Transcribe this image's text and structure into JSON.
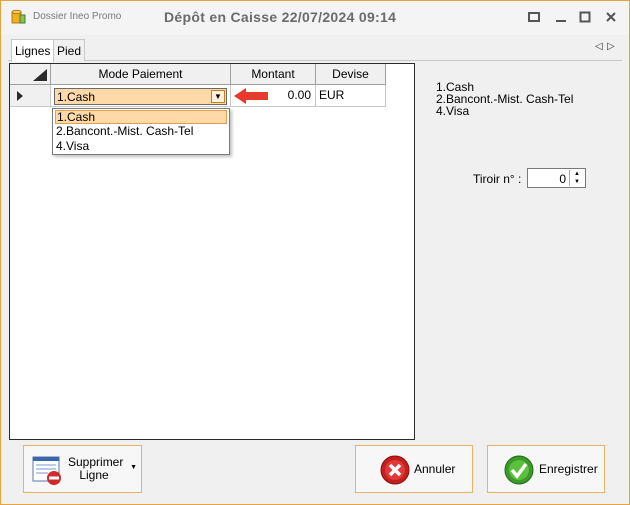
{
  "window": {
    "app_name": "Dossier Ineo Promo",
    "title": "Dépôt en Caisse 22/07/2024 09:14",
    "accent_color": "#e8a33d"
  },
  "tabs": [
    {
      "label": "Lignes",
      "active": true
    },
    {
      "label": "Pied",
      "active": false
    }
  ],
  "grid": {
    "columns": [
      "Mode Paiement",
      "Montant",
      "Devise"
    ],
    "rows": [
      {
        "mode": "1.Cash",
        "montant": "0.00",
        "devise": "EUR"
      }
    ]
  },
  "dropdown": {
    "options": [
      "1.Cash",
      "2.Bancont.-Mist. Cash-Tel",
      "4.Visa"
    ],
    "selected": "1.Cash"
  },
  "legend": [
    "1.Cash",
    "2.Bancont.-Mist. Cash-Tel",
    "4.Visa"
  ],
  "tiroir": {
    "label": "Tiroir n° :",
    "value": "0"
  },
  "buttons": {
    "supprimer_line1": "Supprimer",
    "supprimer_line2": "Ligne",
    "annuler": "Annuler",
    "enregistrer": "Enregistrer"
  }
}
